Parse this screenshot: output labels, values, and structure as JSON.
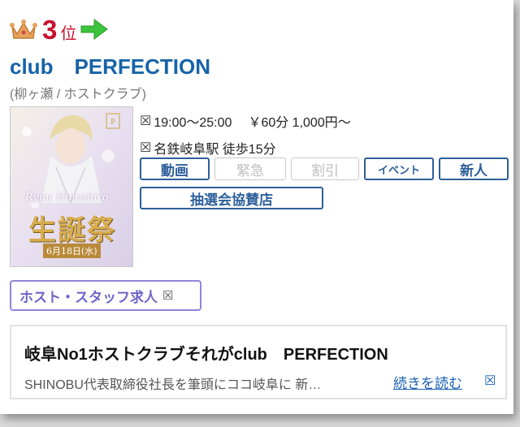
{
  "rank": {
    "number": "3",
    "suffix": "位"
  },
  "club": {
    "name": "club　PERFECTION",
    "subtitle": "(柳ヶ瀬 / ホストクラブ)"
  },
  "thumbnail": {
    "name_script": "Ryuu Hinoshiro",
    "event_title": "生誕祭",
    "date": "6月18日(水)"
  },
  "info": {
    "hours_icon": "☒",
    "hours": "19:00～25:00",
    "price": "￥60分 1,000円～",
    "access_icon": "☒",
    "access": "名鉄岐阜駅 徒歩15分"
  },
  "buttons": {
    "video": "動画",
    "urgent": "緊急",
    "discount": "割引",
    "event": "イベント",
    "newcomer": "新人",
    "lottery": "抽選会協賛店"
  },
  "recruit": {
    "label": "ホスト・スタッフ求人",
    "icon": "☒"
  },
  "description": {
    "title": "岐阜No1ホストクラブそれがclub　PERFECTION",
    "text": "SHINOBU代表取締役社長を筆頭にココ岐阜に 新…",
    "read_more": "続きを読む",
    "read_more_icon": "☒"
  },
  "colors": {
    "rank": "#c8102e",
    "club_name": "#1763a8",
    "button_border": "#2d5f9a",
    "recruit_border": "#8f86d8",
    "link": "#1a5fb4",
    "arrow": "#3cc43c",
    "crown": "#e39c4a"
  },
  "icons": {
    "crown": "crown-icon",
    "arrow": "arrow-right-icon"
  }
}
